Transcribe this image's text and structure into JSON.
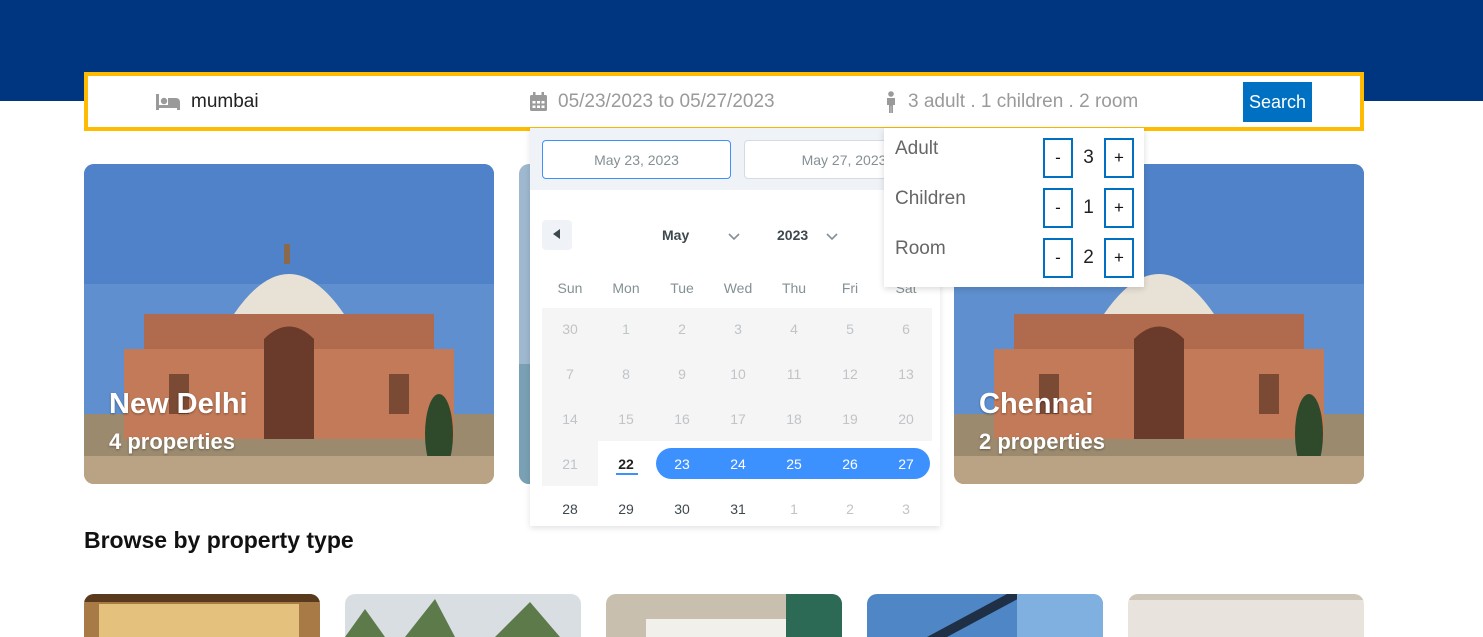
{
  "search": {
    "destination": "mumbai",
    "date_range": "05/23/2023 to 05/27/2023",
    "guests_summary": "3 adult . 1 children . 2 room",
    "button_label": "Search",
    "icons": [
      "bed-icon",
      "calendar-icon",
      "person-icon"
    ]
  },
  "datepicker": {
    "start_input": "May 23, 2023",
    "end_input": "May 27, 2023",
    "month": "May",
    "year": "2023",
    "weekdays": [
      "Sun",
      "Mon",
      "Tue",
      "Wed",
      "Thu",
      "Fri",
      "Sat"
    ],
    "weeks": [
      [
        "30",
        "1",
        "2",
        "3",
        "4",
        "5",
        "6"
      ],
      [
        "7",
        "8",
        "9",
        "10",
        "11",
        "12",
        "13"
      ],
      [
        "14",
        "15",
        "16",
        "17",
        "18",
        "19",
        "20"
      ],
      [
        "21",
        "22",
        "23",
        "24",
        "25",
        "26",
        "27"
      ],
      [
        "28",
        "29",
        "30",
        "31",
        "1",
        "2",
        "3"
      ]
    ],
    "today": "22",
    "selected_range": [
      "23",
      "27"
    ],
    "accent_color": "#3d91ff"
  },
  "guests": {
    "rows": [
      {
        "label": "Adult",
        "minus": "-",
        "value": "3",
        "plus": "+"
      },
      {
        "label": "Children",
        "minus": "-",
        "value": "1",
        "plus": "+"
      },
      {
        "label": "Room",
        "minus": "-",
        "value": "2",
        "plus": "+"
      }
    ]
  },
  "featured": [
    {
      "city": "New Delhi",
      "count": "4 properties"
    },
    {
      "city": "",
      "count": ""
    },
    {
      "city": "Chennai",
      "count": "2 properties"
    }
  ],
  "browse_title": "Browse by property type",
  "colors": {
    "header_blue": "#003580",
    "search_border": "#febb02",
    "button_blue": "#0071c2"
  }
}
